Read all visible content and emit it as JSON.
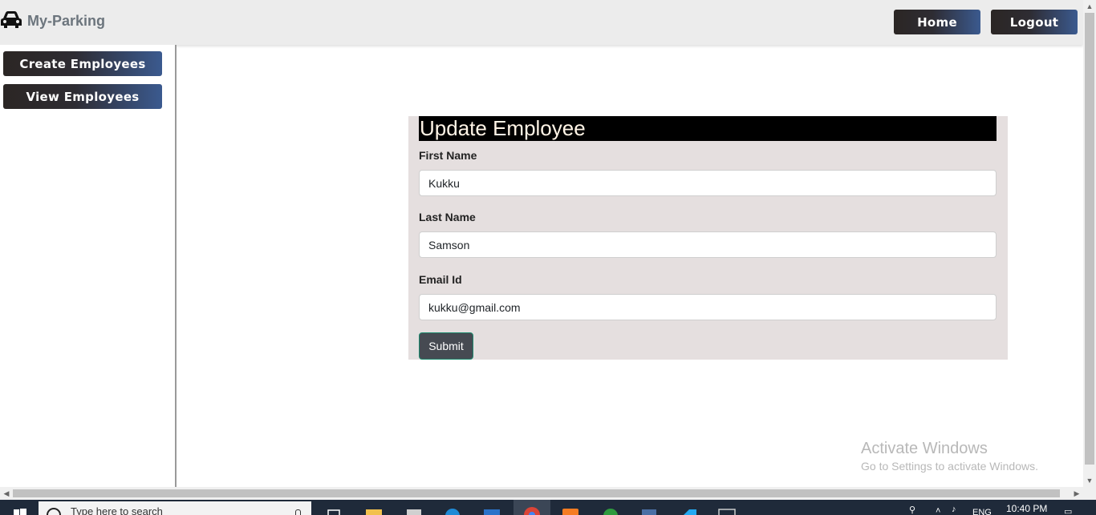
{
  "app": {
    "brand_title": "My-Parking",
    "brand_icon": "car-icon"
  },
  "nav": {
    "home_label": "Home",
    "logout_label": "Logout"
  },
  "sidebar": {
    "items": [
      {
        "label": "Create Employees"
      },
      {
        "label": "View Employees"
      }
    ]
  },
  "form": {
    "title": "Update Employee",
    "fields": [
      {
        "label": "First Name",
        "value": "Kukku"
      },
      {
        "label": "Last Name",
        "value": "Samson"
      },
      {
        "label": "Email Id",
        "value": "kukku@gmail.com"
      }
    ],
    "submit_label": "Submit"
  },
  "watermark": {
    "line1": "Activate Windows",
    "line2": "Go to Settings to activate Windows."
  },
  "taskbar": {
    "search_placeholder": "Type here to search",
    "tray_language": "ENG",
    "clock_time": "10:40 PM"
  },
  "colors": {
    "navbar_bg": "#ececec",
    "button_gradient_start": "#2b2624",
    "button_gradient_end": "#3b5a8f",
    "panel_bg": "#e5dfdf",
    "panel_title_bg": "#000000",
    "submit_bg": "#464a52",
    "taskbar_bg": "#1f2a3a"
  }
}
